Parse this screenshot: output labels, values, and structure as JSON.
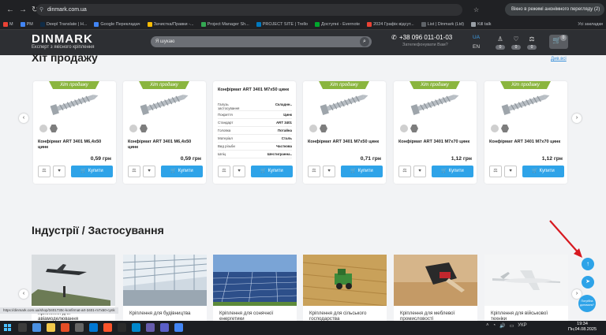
{
  "browser": {
    "url": "dinmark.com.ua",
    "incognito_label": "Вікно в режимі анонімного перегляду (2)",
    "bookmarks": [
      "M",
      "PM",
      "Deepl Translate | Н...",
      "Google Перекладач",
      "Зачистка/Правки -...",
      "Project Manager Sh...",
      "PROJECT SITE | Trello",
      "Доступні - Evernote",
      "2024 Графік відсут...",
      "List | Dinmark (Ltd)",
      "Kill talk"
    ],
    "bookmarks_all": "Усі закладки"
  },
  "header": {
    "logo": "DINMARK",
    "tagline": "Експерт з якісного кріплення",
    "search_placeholder": "Я шукаю",
    "phone": "+38 096 011-01-03",
    "callback": "Зателефонувати Вам?",
    "lang_active": "UA",
    "lang_other": "EN",
    "counters": [
      "0",
      "0",
      "0"
    ],
    "cart_count": "0"
  },
  "hits": {
    "title": "Хіт продажу",
    "see_all": "Див.всі",
    "ribbon": "Хіт продажу",
    "buy_label": "Купити",
    "products": [
      {
        "name": "Конфірмат ART 3401 M6,4x50 цинк",
        "price": "0,59 грн"
      },
      {
        "name": "Конфірмат ART 3401 M6,4x50 цинк",
        "price": "0,59 грн"
      },
      {
        "name": "Конфірмат ART 3401 M7x50 цинк",
        "price": "0,71 грн"
      },
      {
        "name": "Конфірмат ART 3401 M7x70 цинк",
        "price": "1,12 грн"
      },
      {
        "name": "Конфірмат ART 3401 M7x70 цинк",
        "price": "1,12 грн"
      }
    ],
    "spec_card": {
      "name": "Конфірмат ART 3401 M7x50 цинк",
      "rows": [
        {
          "k": "Галузь застосування",
          "v": "Складнн.."
        },
        {
          "k": "Покриття",
          "v": "Цинк"
        },
        {
          "k": "Стандарт",
          "v": "ART 3401"
        },
        {
          "k": "Головка",
          "v": "Потайна"
        },
        {
          "k": "Матеріал",
          "v": "Сталь"
        },
        {
          "k": "Вид різьби",
          "v": "Часткова"
        },
        {
          "k": "Шліц",
          "v": "Шестигранна.."
        }
      ]
    }
  },
  "industries": {
    "title": "Індустрії / Застосування",
    "items": [
      "Кріплення для авіамоделювання",
      "Кріплення для будівництва",
      "Кріплення для сонячної енергетики",
      "Кріплення для сільського господарства",
      "Кріплення для меблевої промисловості",
      "Кріплення для військової техніки"
    ]
  },
  "floating": {
    "help_line1": "Потрібна",
    "help_line2": "допомога?"
  },
  "status_url": "https://dinmark.com.ua/shop/3401730c-konfirmat-art-3401-m7x50-cynk",
  "taskbar": {
    "lang": "УКР",
    "time": "19:34",
    "date": "Пн,04.08.2025"
  }
}
